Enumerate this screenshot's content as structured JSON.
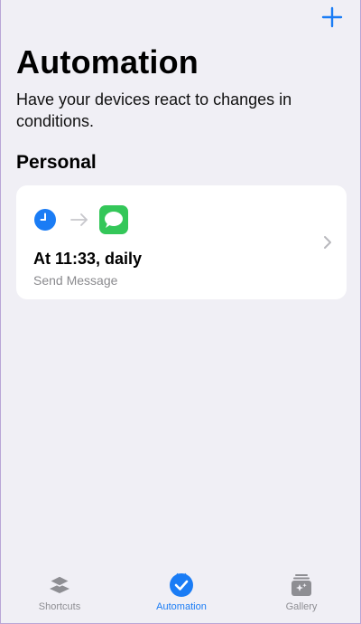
{
  "header": {
    "title": "Automation",
    "subtitle": "Have your devices react to changes in conditions."
  },
  "section": {
    "title": "Personal"
  },
  "automations": [
    {
      "title": "At 11:33, daily",
      "subtitle": "Send Message",
      "trigger_icon": "clock-icon",
      "action_icon": "messages-icon"
    }
  ],
  "tabbar": {
    "tabs": [
      {
        "label": "Shortcuts",
        "icon": "layers-icon",
        "active": false
      },
      {
        "label": "Automation",
        "icon": "automation-check-icon",
        "active": true
      },
      {
        "label": "Gallery",
        "icon": "gallery-icon",
        "active": false
      }
    ]
  },
  "colors": {
    "accent": "#1a7cf5",
    "background": "#f0eff5",
    "messages_green": "#34c759",
    "inactive": "#8e8e93"
  }
}
